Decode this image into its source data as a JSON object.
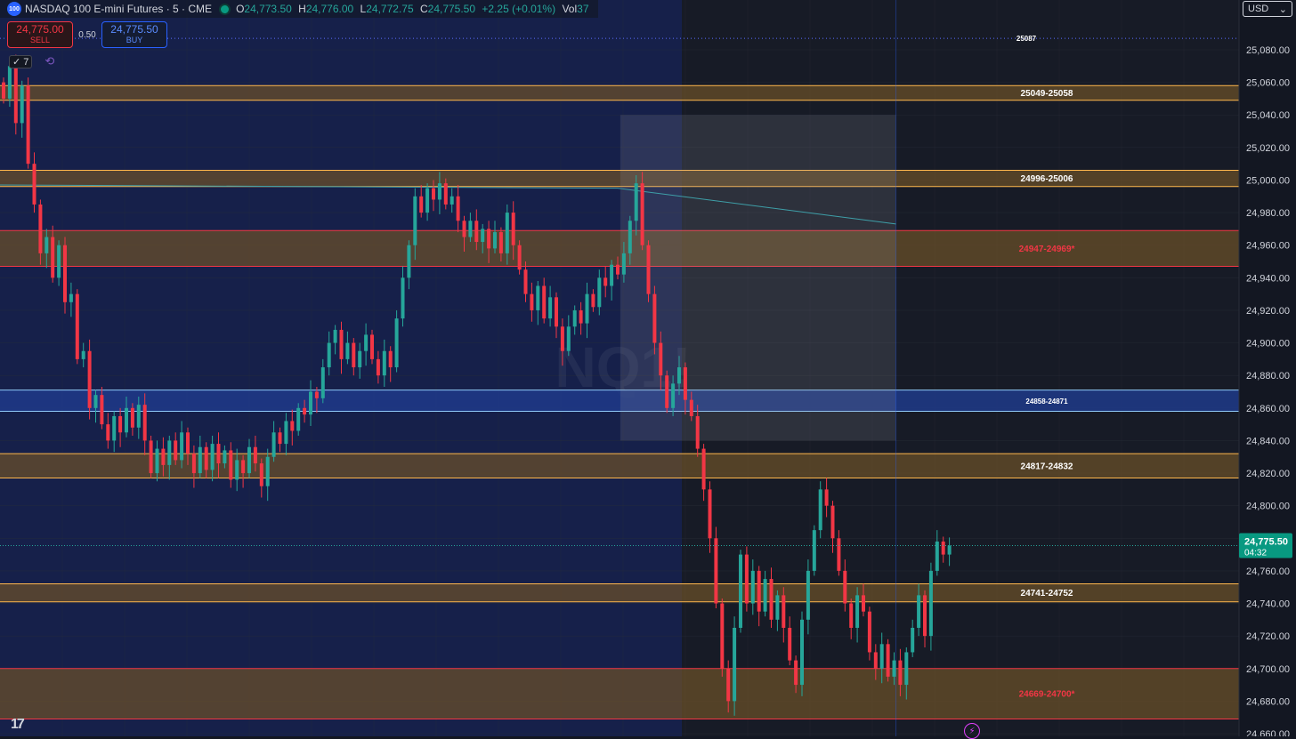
{
  "header": {
    "symbol_icon": "100",
    "title": "NASDAQ 100 E-mini Futures · 5 · CME",
    "open_label": "O",
    "open": "24,773.50",
    "high_label": "H",
    "high": "24,776.00",
    "low_label": "L",
    "low": "24,772.75",
    "close_label": "C",
    "close": "24,775.50",
    "change": "+2.25 (+0.01%)",
    "vol_label": "Vol",
    "vol": "37"
  },
  "trade": {
    "sell_price": "24,775.00",
    "sell_label": "SELL",
    "spread": "0.50",
    "buy_price": "24,775.50",
    "buy_label": "BUY"
  },
  "indicators": {
    "count": "7",
    "check_icon": "check-icon",
    "sync_icon": "sync-icon"
  },
  "currency": {
    "label": "USD",
    "caret": "⌄"
  },
  "watermark": "NQ1!",
  "colors": {
    "background": "#131722",
    "up": "#26a69a",
    "down": "#f23645",
    "zone_fill": "#6e5128",
    "zone_blue": "#1e3a8a",
    "vwap": "#3e9fa8"
  },
  "chart_data": {
    "type": "candlestick",
    "title": "NASDAQ 100 E-mini Futures",
    "symbol": "NQ1!",
    "interval": "5",
    "exchange": "CME",
    "ylim": [
      24658,
      25100
    ],
    "yticks": [
      24660,
      24680,
      24700,
      24720,
      24740,
      24760,
      24780,
      24800,
      24820,
      24840,
      24860,
      24880,
      24900,
      24920,
      24940,
      24960,
      24980,
      25000,
      25020,
      25040,
      25060,
      25080
    ],
    "ytick_labels": [
      "24,660.00",
      "24,680.00",
      "24,700.00",
      "24,720.00",
      "24,740.00",
      "24,760.00",
      "24,780.00",
      "24,800.00",
      "24,820.00",
      "24,840.00",
      "24,860.00",
      "24,880.00",
      "24,900.00",
      "24,920.00",
      "24,940.00",
      "24,960.00",
      "24,980.00",
      "25,000.00",
      "25,020.00",
      "25,040.00",
      "25,060.00",
      "25,080.00"
    ],
    "last_price": 24775.5,
    "last_price_label": "24,775.50",
    "countdown": "04:32",
    "levels": [
      {
        "label": "25087",
        "value": 25087,
        "style": "dotted"
      }
    ],
    "zones": [
      {
        "label": "25049-25058",
        "low": 25049,
        "high": 25058,
        "kind": "orange",
        "label_color": "white"
      },
      {
        "label": "24996-25006",
        "low": 24996,
        "high": 25006,
        "kind": "orange",
        "label_color": "white"
      },
      {
        "label": "24947-24969*",
        "low": 24947,
        "high": 24969,
        "kind": "red",
        "label_color": "red"
      },
      {
        "label": "24858-24871",
        "low": 24858,
        "high": 24871,
        "kind": "blue",
        "label_color": "white"
      },
      {
        "label": "24817-24832",
        "low": 24817,
        "high": 24832,
        "kind": "orange",
        "label_color": "white"
      },
      {
        "label": "24741-24752",
        "low": 24741,
        "high": 24752,
        "kind": "orange",
        "label_color": "white"
      },
      {
        "label": "24669-24700*",
        "low": 24669,
        "high": 24700,
        "kind": "red",
        "label_color": "red"
      }
    ],
    "vwap": {
      "start": 24997,
      "flat_until_bar": 100,
      "end": 24973
    },
    "range_box": {
      "from_bar": 101,
      "to_bar": 145,
      "high": 25040,
      "low": 24840
    },
    "candles": [
      [
        25060,
        25050
      ],
      [
        25050,
        25070
      ],
      [
        25070,
        25035
      ],
      [
        25035,
        25058
      ],
      [
        25058,
        25010
      ],
      [
        25010,
        24985
      ],
      [
        24985,
        24955
      ],
      [
        24955,
        24965
      ],
      [
        24965,
        24940
      ],
      [
        24940,
        24960
      ],
      [
        24960,
        24925
      ],
      [
        24925,
        24930
      ],
      [
        24930,
        24890
      ],
      [
        24890,
        24895
      ],
      [
        24895,
        24860
      ],
      [
        24860,
        24868
      ],
      [
        24868,
        24850
      ],
      [
        24850,
        24840
      ],
      [
        24840,
        24855
      ],
      [
        24855,
        24845
      ],
      [
        24845,
        24860
      ],
      [
        24860,
        24848
      ],
      [
        24848,
        24862
      ],
      [
        24862,
        24840
      ],
      [
        24840,
        24820
      ],
      [
        24820,
        24835
      ],
      [
        24835,
        24825
      ],
      [
        24825,
        24840
      ],
      [
        24840,
        24828
      ],
      [
        24828,
        24845
      ],
      [
        24845,
        24832
      ],
      [
        24832,
        24820
      ],
      [
        24820,
        24836
      ],
      [
        24836,
        24822
      ],
      [
        24822,
        24838
      ],
      [
        24838,
        24826
      ],
      [
        24826,
        24834
      ],
      [
        24834,
        24816
      ],
      [
        24816,
        24828
      ],
      [
        24828,
        24820
      ],
      [
        24820,
        24836
      ],
      [
        24836,
        24826
      ],
      [
        24826,
        24812
      ],
      [
        24812,
        24830
      ],
      [
        24830,
        24845
      ],
      [
        24845,
        24838
      ],
      [
        24838,
        24852
      ],
      [
        24852,
        24846
      ],
      [
        24846,
        24860
      ],
      [
        24860,
        24856
      ],
      [
        24856,
        24870
      ],
      [
        24870,
        24866
      ],
      [
        24866,
        24885
      ],
      [
        24885,
        24900
      ],
      [
        24900,
        24908
      ],
      [
        24908,
        24890
      ],
      [
        24890,
        24900
      ],
      [
        24900,
        24885
      ],
      [
        24885,
        24895
      ],
      [
        24895,
        24905
      ],
      [
        24905,
        24890
      ],
      [
        24890,
        24880
      ],
      [
        24880,
        24895
      ],
      [
        24895,
        24885
      ],
      [
        24885,
        24915
      ],
      [
        24915,
        24940
      ],
      [
        24940,
        24960
      ],
      [
        24960,
        24990
      ],
      [
        24990,
        24980
      ],
      [
        24980,
        24995
      ],
      [
        24995,
        24988
      ],
      [
        24988,
        24998
      ],
      [
        24998,
        24985
      ],
      [
        24985,
        24990
      ],
      [
        24990,
        24975
      ],
      [
        24975,
        24965
      ],
      [
        24965,
        24975
      ],
      [
        24975,
        24962
      ],
      [
        24962,
        24970
      ],
      [
        24970,
        24958
      ],
      [
        24958,
        24968
      ],
      [
        24968,
        24955
      ],
      [
        24955,
        24980
      ],
      [
        24980,
        24960
      ],
      [
        24960,
        24945
      ],
      [
        24945,
        24930
      ],
      [
        24930,
        24920
      ],
      [
        24920,
        24935
      ],
      [
        24935,
        24915
      ],
      [
        24915,
        24928
      ],
      [
        24928,
        24910
      ],
      [
        24910,
        24895
      ],
      [
        24895,
        24910
      ],
      [
        24910,
        24920
      ],
      [
        24920,
        24912
      ],
      [
        24912,
        24930
      ],
      [
        24930,
        24922
      ],
      [
        24922,
        24940
      ],
      [
        24940,
        24935
      ],
      [
        24935,
        24948
      ],
      [
        24948,
        24942
      ],
      [
        24942,
        24955
      ],
      [
        24955,
        24975
      ],
      [
        24975,
        24998
      ],
      [
        24998,
        24960
      ],
      [
        24960,
        24930
      ],
      [
        24930,
        24900
      ],
      [
        24900,
        24880
      ],
      [
        24880,
        24860
      ],
      [
        24860,
        24875
      ],
      [
        24875,
        24885
      ],
      [
        24885,
        24865
      ],
      [
        24865,
        24855
      ],
      [
        24855,
        24835
      ],
      [
        24835,
        24810
      ],
      [
        24810,
        24780
      ],
      [
        24780,
        24740
      ],
      [
        24740,
        24700
      ],
      [
        24700,
        24680
      ],
      [
        24680,
        24725
      ],
      [
        24725,
        24770
      ],
      [
        24770,
        24740
      ],
      [
        24740,
        24760
      ],
      [
        24760,
        24735
      ],
      [
        24735,
        24755
      ],
      [
        24755,
        24730
      ],
      [
        24730,
        24745
      ],
      [
        24745,
        24725
      ],
      [
        24725,
        24705
      ],
      [
        24705,
        24690
      ],
      [
        24690,
        24730
      ],
      [
        24730,
        24760
      ],
      [
        24760,
        24785
      ],
      [
        24785,
        24810
      ],
      [
        24810,
        24800
      ],
      [
        24800,
        24780
      ],
      [
        24780,
        24760
      ],
      [
        24760,
        24740
      ],
      [
        24740,
        24725
      ],
      [
        24725,
        24745
      ],
      [
        24745,
        24735
      ],
      [
        24735,
        24710
      ],
      [
        24710,
        24700
      ],
      [
        24700,
        24715
      ],
      [
        24715,
        24695
      ],
      [
        24695,
        24705
      ],
      [
        24705,
        24690
      ],
      [
        24690,
        24710
      ],
      [
        24710,
        24725
      ],
      [
        24725,
        24745
      ],
      [
        24745,
        24720
      ],
      [
        24720,
        24760
      ],
      [
        24760,
        24778
      ],
      [
        24778,
        24770
      ],
      [
        24770,
        24775.5
      ]
    ]
  }
}
